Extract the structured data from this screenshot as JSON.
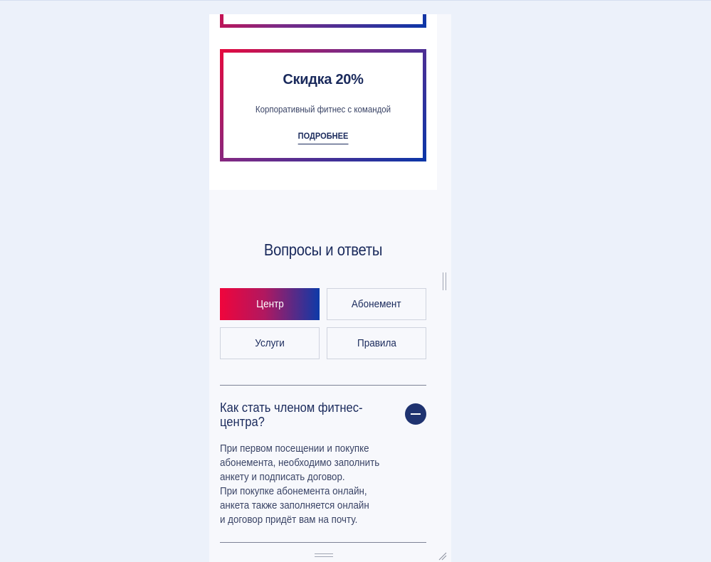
{
  "promo": {
    "title": "Скидка 20%",
    "description": "Корпоративный фитнес с командой",
    "link_label": "ПОДРОБНЕЕ"
  },
  "faq": {
    "title": "Вопросы и ответы",
    "tabs": [
      {
        "label": "Центр",
        "active": true
      },
      {
        "label": "Абонемент",
        "active": false
      },
      {
        "label": "Услуги",
        "active": false
      },
      {
        "label": "Правила",
        "active": false
      }
    ],
    "item": {
      "question": "Как стать членом фитнес-центра?",
      "answer_lines": [
        "При первом посещении и покупке",
        "абонемента, необходимо заполнить",
        "анкету и подписать договор.",
        "При покупке абонемента онлайн,",
        "анкета также заполняется онлайн",
        "и договор придёт вам на почту."
      ]
    }
  },
  "colors": {
    "navy": "#1a2a5c",
    "gradient_start": "#e6093d",
    "gradient_end": "#0a36a8",
    "page_bg": "#ecf1fa"
  },
  "icons": {
    "collapse": "minus-circle-icon",
    "scroll_handle": "scroll-handle-icon",
    "drag_handle": "drag-handle-icon",
    "resize": "resize-grip-icon"
  }
}
